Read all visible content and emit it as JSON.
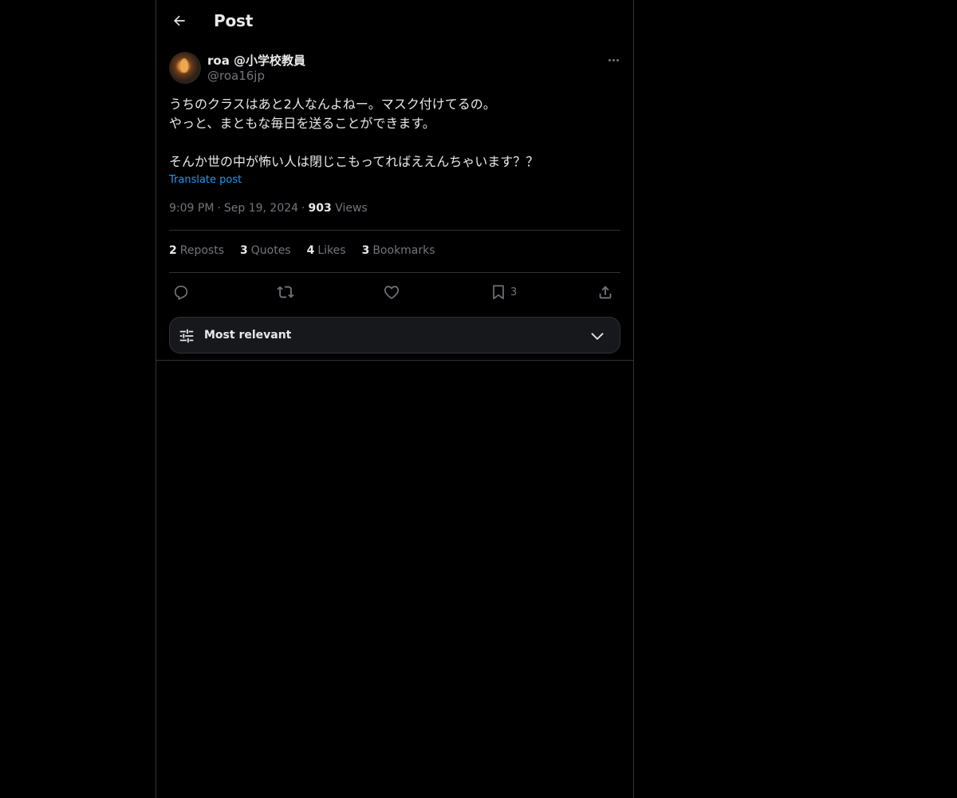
{
  "header": {
    "title": "Post"
  },
  "author": {
    "display_name": "roa @小学校教員",
    "handle": "@roa16jp"
  },
  "post": {
    "lines": [
      "うちのクラスはあと2人なんよねー。マスク付けてるの。",
      "やっと、まともな毎日を送ることができます。",
      "",
      "そんか世の中が怖い人は閉じこもってればええんちゃいます？？"
    ],
    "translate_label": "Translate post",
    "time": "9:09 PM",
    "date": "Sep 19, 2024",
    "views_count": "903",
    "views_label": "Views"
  },
  "stats": {
    "reposts_count": "2",
    "reposts_label": "Reposts",
    "quotes_count": "3",
    "quotes_label": "Quotes",
    "likes_count": "4",
    "likes_label": "Likes",
    "bookmarks_count": "3",
    "bookmarks_label": "Bookmarks"
  },
  "actions": {
    "bookmark_count": "3"
  },
  "sort": {
    "label": "Most relevant"
  },
  "icons": {
    "back": "arrow-left-icon",
    "more": "more-horizontal-icon",
    "reply": "reply-icon",
    "repost": "repost-icon",
    "like": "heart-icon",
    "bookmark": "bookmark-icon",
    "share": "share-icon",
    "sort": "sliders-icon",
    "chevron": "chevron-down-icon"
  },
  "colors": {
    "background": "#000000",
    "text": "#e7e9ea",
    "muted": "#71767b",
    "link": "#1d9bf0",
    "border": "#2f3336"
  }
}
